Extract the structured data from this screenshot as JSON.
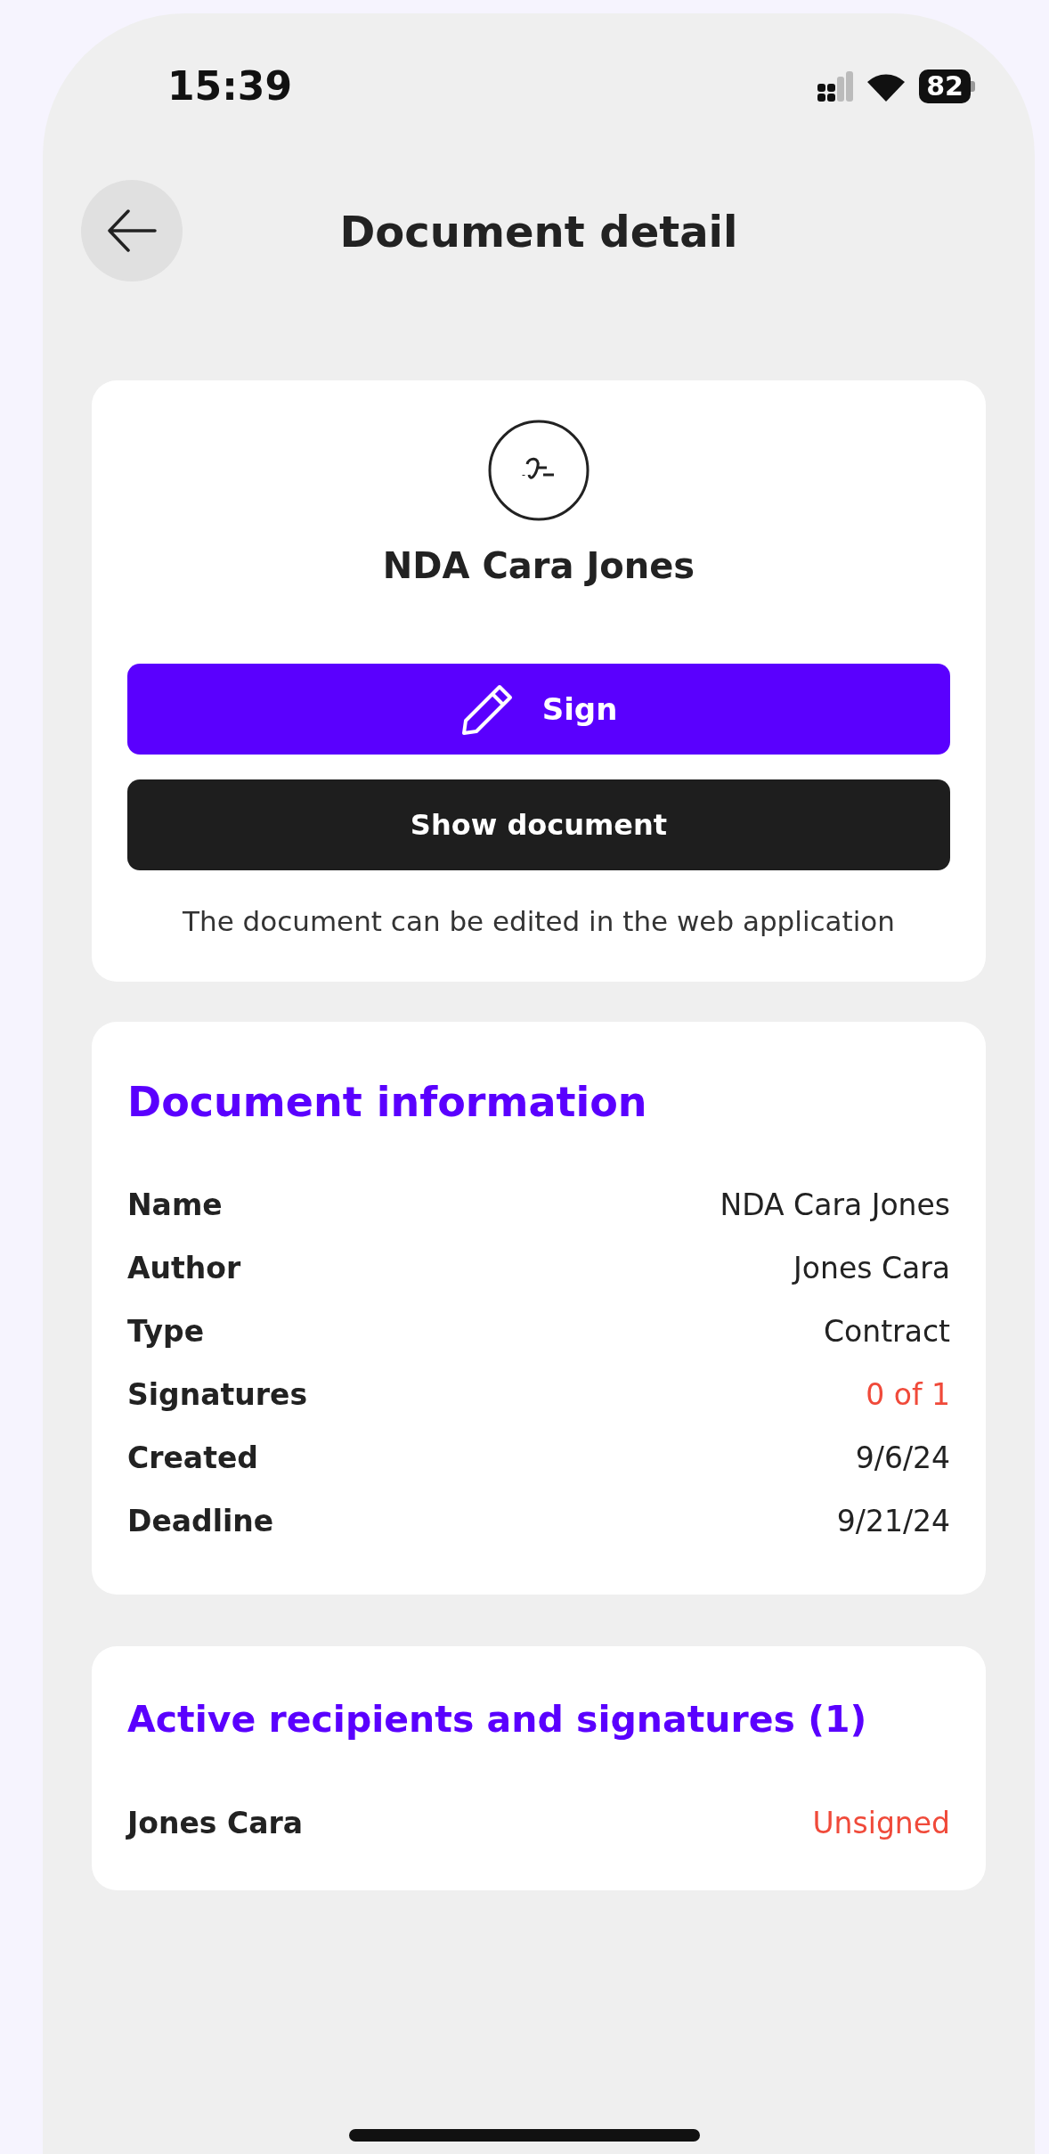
{
  "status_bar": {
    "time": "15:39",
    "battery": "82"
  },
  "header": {
    "title": "Document detail"
  },
  "document_card": {
    "title": "NDA Cara Jones",
    "sign_button": "Sign",
    "show_button": "Show document",
    "note": "The document can be edited in the web application"
  },
  "info_card": {
    "heading": "Document information",
    "rows": [
      {
        "label": "Name",
        "value": "NDA Cara Jones",
        "alert": false
      },
      {
        "label": "Author",
        "value": "Jones Cara",
        "alert": false
      },
      {
        "label": "Type",
        "value": "Contract",
        "alert": false
      },
      {
        "label": "Signatures",
        "value": "0 of 1",
        "alert": true
      },
      {
        "label": "Created",
        "value": "9/6/24",
        "alert": false
      },
      {
        "label": "Deadline",
        "value": "9/21/24",
        "alert": false
      }
    ]
  },
  "recipients_card": {
    "heading": "Active recipients and signatures (1)",
    "rows": [
      {
        "name": "Jones Cara",
        "status": "Unsigned",
        "alert": true
      }
    ]
  }
}
